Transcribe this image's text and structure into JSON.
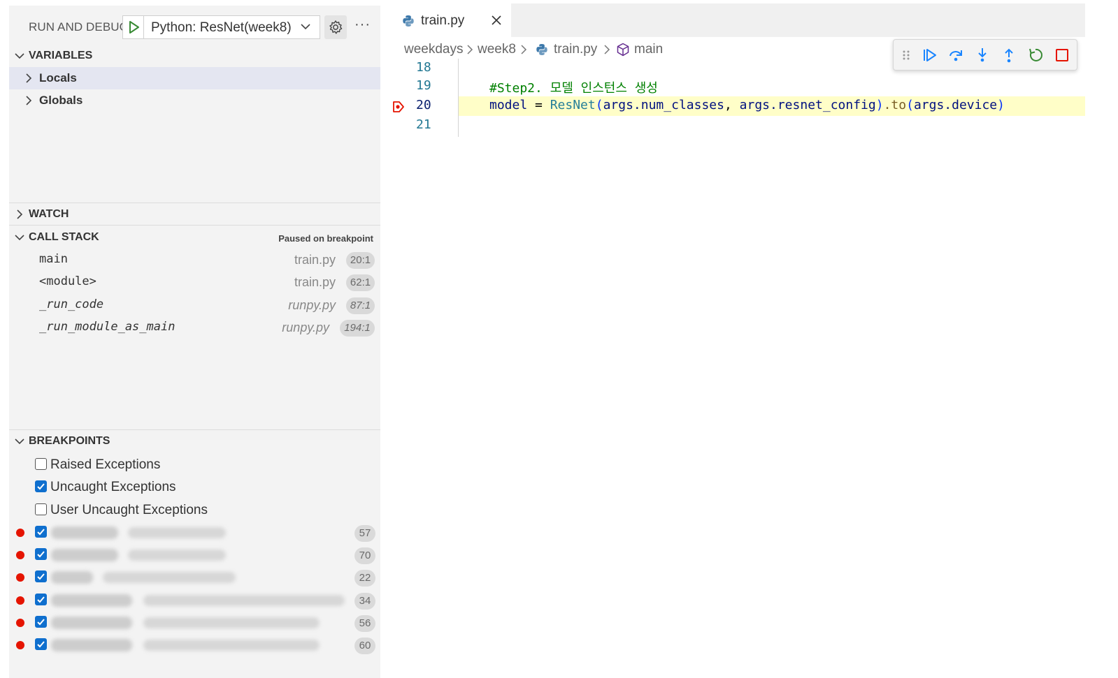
{
  "sidebar": {
    "title": "RUN AND DEBUG",
    "launch_config": "Python: ResNet(week8)",
    "sections": {
      "variables": "VARIABLES",
      "watch": "WATCH",
      "call_stack": "CALL STACK",
      "breakpoints": "BREAKPOINTS"
    },
    "variables": [
      "Locals",
      "Globals"
    ],
    "call_stack_status": "Paused on breakpoint",
    "frames": [
      {
        "name": "main",
        "file": "train.py",
        "line": "20:1"
      },
      {
        "name": "<module>",
        "file": "train.py",
        "line": "62:1"
      },
      {
        "name": "_run_code",
        "file": "runpy.py",
        "line": "87:1"
      },
      {
        "name": "_run_module_as_main",
        "file": "runpy.py",
        "line": "194:1"
      }
    ],
    "exception_filters": [
      {
        "label": "Raised Exceptions",
        "checked": false
      },
      {
        "label": "Uncaught Exceptions",
        "checked": true
      },
      {
        "label": "User Uncaught Exceptions",
        "checked": false
      }
    ],
    "breakpoint_lines": [
      "57",
      "70",
      "22",
      "34",
      "56",
      "60"
    ]
  },
  "editor": {
    "tab_label": "train.py",
    "breadcrumb": [
      "weekdays",
      "week8",
      "train.py",
      "main"
    ],
    "line_numbers": [
      "18",
      "19",
      "20",
      "21"
    ],
    "code": {
      "comment": "#Step2. 모델 인스턴스 생성",
      "model": "model",
      "eq": " = ",
      "class": "ResNet",
      "p1": "(",
      "args1": "args.num_classes",
      "comma": ", ",
      "args2": "args.resnet_config",
      "p2": ")",
      "dot_to": ".to",
      "p3": "(",
      "args3": "args.device",
      "p4": ")"
    }
  },
  "colors": {
    "accent": "#0f6fce",
    "breakpoint": "#e51400",
    "current_line": "#fffec8",
    "continue": "#1a85ff",
    "restart": "#388a34",
    "stop": "#e51400"
  },
  "icons": [
    "play-icon",
    "gear-icon",
    "more-icon",
    "python-file-icon",
    "close-icon",
    "symbol-method-icon",
    "continue-icon",
    "step-over-icon",
    "step-into-icon",
    "step-out-icon",
    "restart-icon",
    "stop-icon",
    "breakpoint-arrow-icon"
  ]
}
